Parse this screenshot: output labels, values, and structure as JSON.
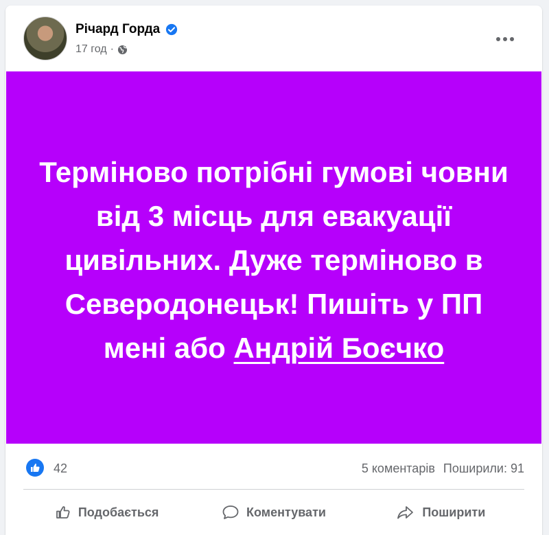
{
  "post": {
    "author": "Річард Горда",
    "time": "17 год",
    "meta_separator": "·",
    "text_main": "Терміново потрібні гумові човни від 3 місць для евакуації цивільних. Дуже терміново в Северодонецьк! Пишіть у ПП мені або ",
    "text_link": "Андрій Боєчко",
    "background_color": "#b600fb"
  },
  "stats": {
    "likes": "42",
    "comments": "5 коментарів",
    "shares": "Поширили: 91"
  },
  "actions": {
    "like": "Подобається",
    "comment": "Коментувати",
    "share": "Поширити"
  },
  "icons": {
    "verified": "verified-badge-icon",
    "privacy": "globe-icon",
    "more": "more-options-icon",
    "like_reaction": "like-reaction-icon",
    "like": "thumbs-up-icon",
    "comment": "comment-icon",
    "share": "share-icon"
  },
  "colors": {
    "brand_blue": "#1877f2",
    "muted_text": "#65676b"
  }
}
